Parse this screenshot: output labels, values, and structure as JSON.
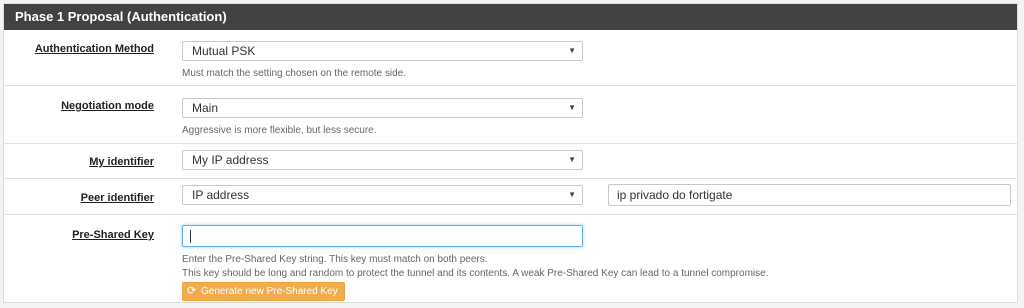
{
  "panel": {
    "title": "Phase 1 Proposal (Authentication)"
  },
  "auth_method": {
    "label": "Authentication Method",
    "value": "Mutual PSK",
    "help": "Must match the setting chosen on the remote side."
  },
  "negotiation_mode": {
    "label": "Negotiation mode",
    "value": "Main",
    "help": "Aggressive is more flexible, but less secure."
  },
  "my_identifier": {
    "label": "My identifier",
    "value": "My IP address"
  },
  "peer_identifier": {
    "label": "Peer identifier",
    "value": "IP address",
    "address_value": "ip privado do fortigate"
  },
  "pre_shared_key": {
    "label": "Pre-Shared Key",
    "value": "",
    "help_line1": "Enter the Pre-Shared Key string. This key must match on both peers.",
    "help_line2": "This key should be long and random to protect the tunnel and its contents. A weak Pre-Shared Key can lead to a tunnel compromise.",
    "generate_button": "Generate new Pre-Shared Key",
    "generate_icon": "refresh-icon"
  },
  "colors": {
    "header_bg": "#424242",
    "warning_button": "#f0ad4e",
    "focus_border": "#66afe9"
  }
}
